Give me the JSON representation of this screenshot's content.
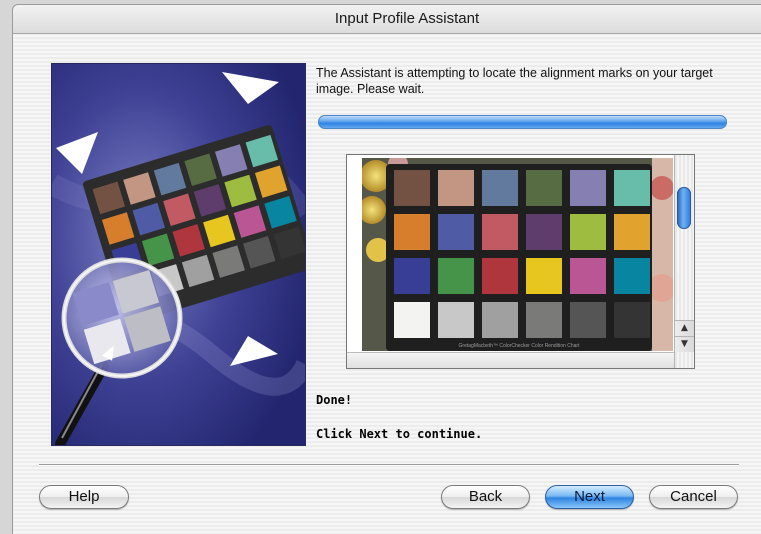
{
  "window": {
    "title": "Input Profile Assistant"
  },
  "message": "The Assistant is attempting to locate the alignment marks on your target image. Please wait.",
  "progress": {
    "fraction": 1.0
  },
  "status": {
    "done": "Done!",
    "next_hint": "Click Next to continue."
  },
  "preview": {
    "caption": "GretagMacbeth™ ColorChecker Color Rendition Chart",
    "scroll_up_glyph": "▲",
    "scroll_down_glyph": "▼"
  },
  "illustration": {
    "chart_caption": "GretagMacbeth™ ColorChecker Color Rendition Chart"
  },
  "buttons": {
    "help": "Help",
    "back": "Back",
    "next": "Next",
    "cancel": "Cancel"
  },
  "colors": {
    "accent": "#2e84e2",
    "checker_swatches": [
      "#735244",
      "#c29682",
      "#627a9d",
      "#576c43",
      "#8580b1",
      "#67bdaa",
      "#d67e2c",
      "#505ba6",
      "#c15a63",
      "#5e3c6c",
      "#9dbc40",
      "#e0a32e",
      "#383d96",
      "#469449",
      "#af363c",
      "#e7c71f",
      "#bb5695",
      "#0885a1",
      "#f3f3f2",
      "#c8c8c8",
      "#a0a0a0",
      "#7a7a79",
      "#555555",
      "#343434"
    ]
  }
}
